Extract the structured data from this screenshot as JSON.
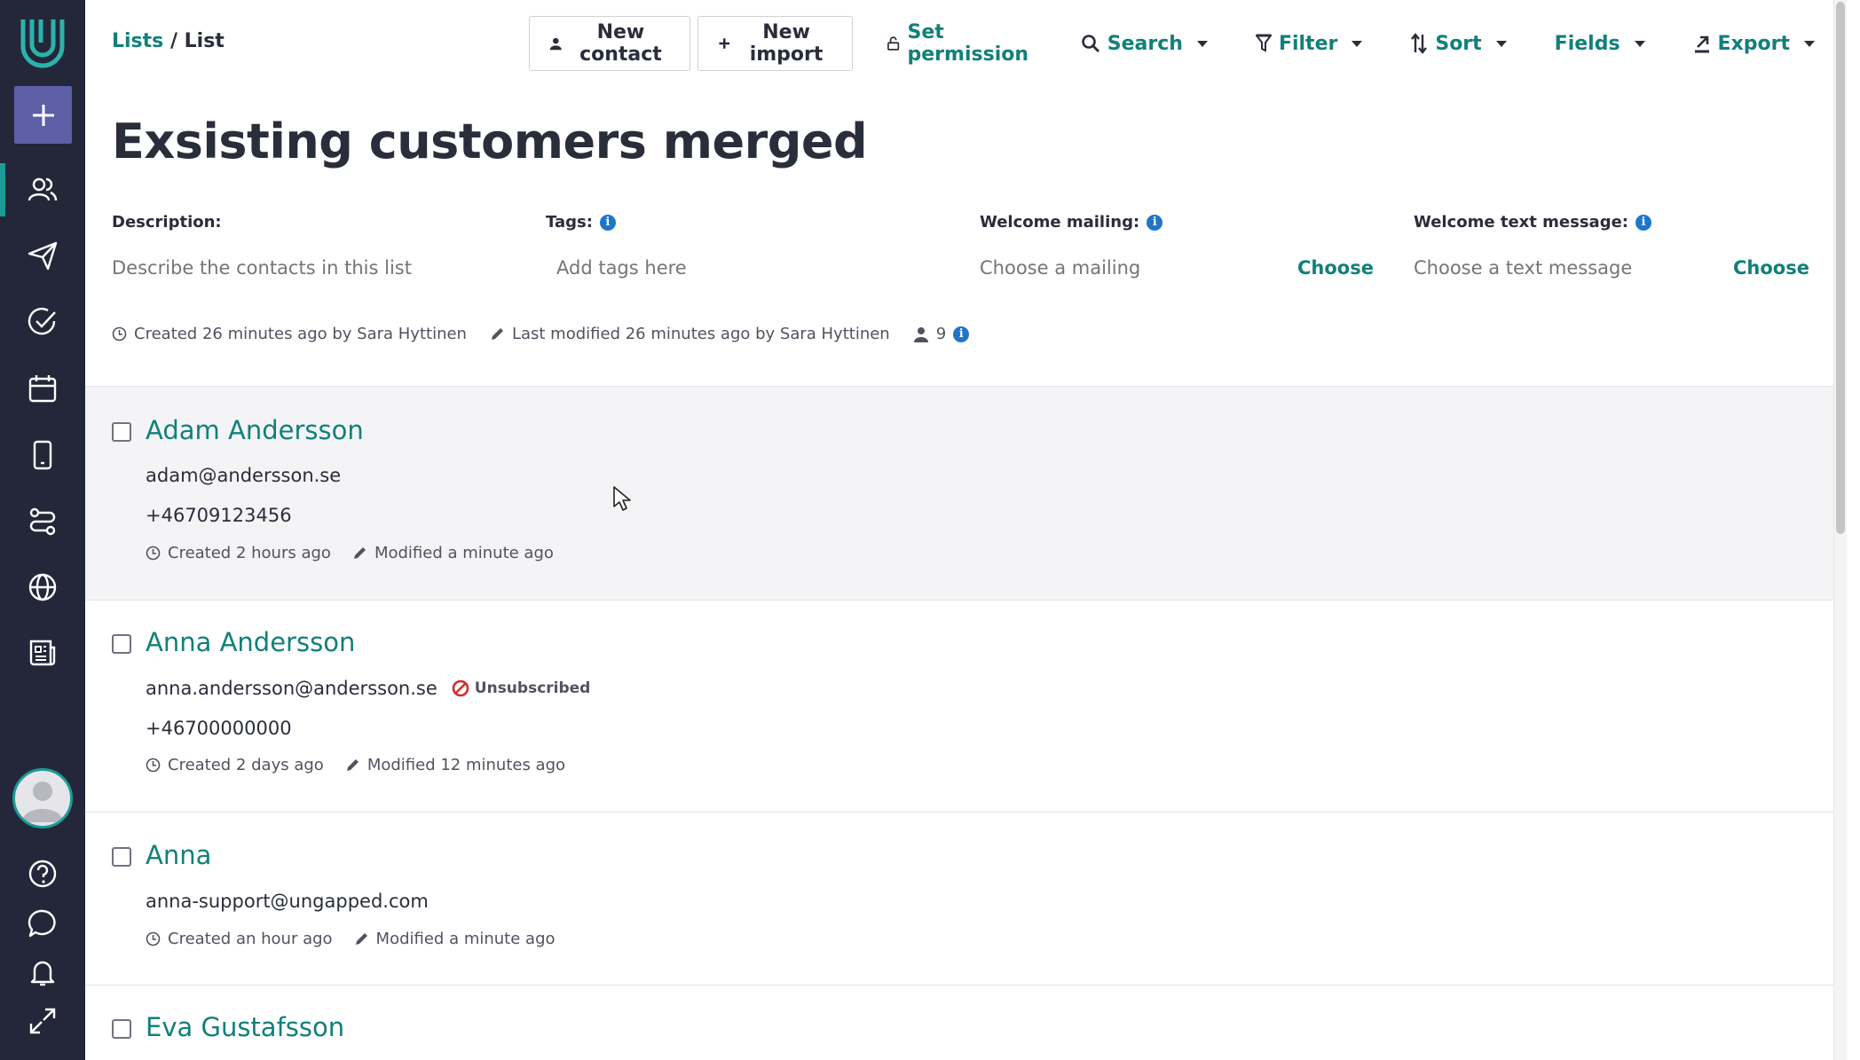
{
  "breadcrumb": {
    "parent": "Lists",
    "separator": "/",
    "current": "List"
  },
  "toolbar": {
    "new_contact": "New contact",
    "new_import": "New import",
    "set_permission": "Set permission",
    "search": "Search",
    "filter": "Filter",
    "sort": "Sort",
    "fields": "Fields",
    "export": "Export"
  },
  "title": "Exsisting customers merged",
  "meta": {
    "description_label": "Description:",
    "description_placeholder": "Describe the contacts in this list",
    "tags_label": "Tags:",
    "tags_placeholder": "Add tags here",
    "mailing_label": "Welcome mailing:",
    "mailing_placeholder": "Choose a mailing",
    "mailing_choose": "Choose",
    "text_label": "Welcome text message:",
    "text_placeholder": "Choose a text message",
    "text_choose": "Choose"
  },
  "info": {
    "created": "Created 26 minutes ago by Sara Hyttinen",
    "modified": "Last modified 26 minutes ago by Sara Hyttinen",
    "count": "9"
  },
  "contacts": [
    {
      "name": "Adam Andersson",
      "email": "adam@andersson.se",
      "phone": "+46709123456",
      "created": "Created 2 hours ago",
      "modified": "Modified a minute ago"
    },
    {
      "name": "Anna Andersson",
      "email": "anna.andersson@andersson.se",
      "status": "Unsubscribed",
      "phone": "+46700000000",
      "created": "Created 2 days ago",
      "modified": "Modified 12 minutes ago"
    },
    {
      "name": "Anna",
      "email": "anna-support@ungapped.com",
      "created": "Created an hour ago",
      "modified": "Modified a minute ago"
    },
    {
      "name": "Eva Gustafsson"
    }
  ],
  "colors": {
    "sidebar": "#24273a",
    "accent": "#11807a",
    "add_button": "#5d60a6",
    "info_icon": "#1f76c9",
    "unsubscribed": "#d62b2b"
  }
}
